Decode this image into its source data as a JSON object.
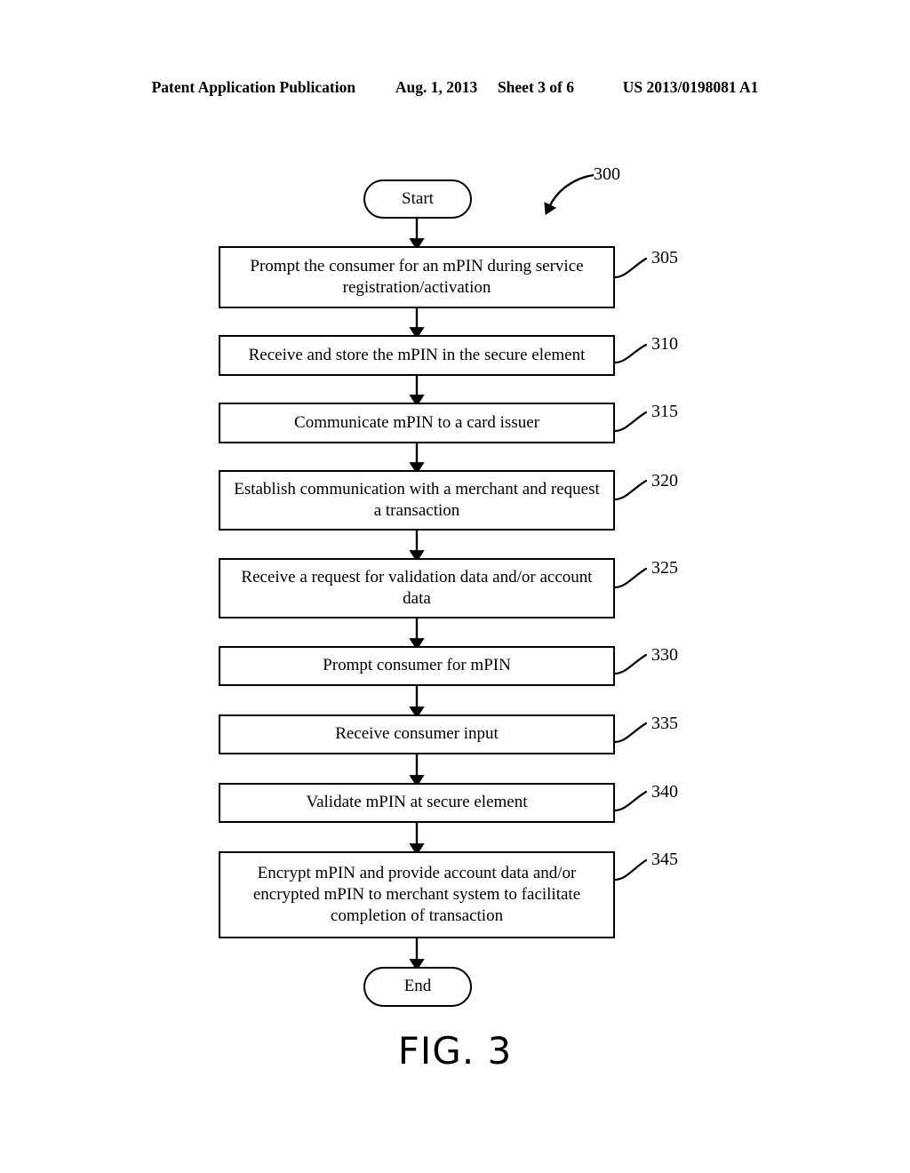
{
  "page_header": {
    "publication": "Patent Application Publication",
    "date": "Aug. 1, 2013",
    "sheet": "Sheet 3 of 6",
    "patent_number": "US 2013/0198081 A1"
  },
  "figure": {
    "caption": "FIG. 3",
    "diagram_ref": "300"
  },
  "flow": {
    "start_label": "Start",
    "end_label": "End",
    "steps": [
      {
        "ref": "305",
        "text": "Prompt the consumer for an mPIN during service registration/activation"
      },
      {
        "ref": "310",
        "text": "Receive and store the mPIN in the secure element"
      },
      {
        "ref": "315",
        "text": "Communicate mPIN to a card issuer"
      },
      {
        "ref": "320",
        "text": "Establish communication with a merchant and request a transaction"
      },
      {
        "ref": "325",
        "text": "Receive a request for validation data and/or account data"
      },
      {
        "ref": "330",
        "text": "Prompt consumer for mPIN"
      },
      {
        "ref": "335",
        "text": "Receive consumer input"
      },
      {
        "ref": "340",
        "text": "Validate mPIN at secure element"
      },
      {
        "ref": "345",
        "text": "Encrypt mPIN and provide account data and/or encrypted mPIN to merchant system to facilitate completion of transaction"
      }
    ]
  },
  "colors": {
    "ink": "#000000",
    "paper": "#ffffff"
  }
}
